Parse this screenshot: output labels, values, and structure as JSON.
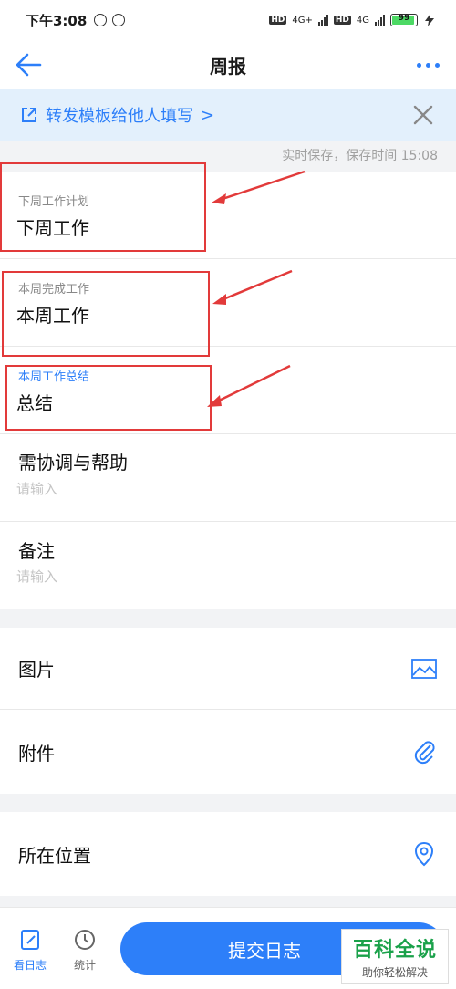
{
  "status_bar": {
    "time": "下午3:08",
    "network_1": "4G+",
    "network_2": "4G",
    "hd": "HD",
    "battery": "99"
  },
  "nav": {
    "title": "周报"
  },
  "banner": {
    "text": "转发模板给他人填写",
    "chevron": ">"
  },
  "save_status": "实时保存，保存时间 15:08",
  "fields": [
    {
      "label": "下周工作计划",
      "value": "下周工作"
    },
    {
      "label": "本周完成工作",
      "value": "本周工作"
    },
    {
      "label": "本周工作总结",
      "value": "总结"
    },
    {
      "label": "需协调与帮助",
      "placeholder": "请输入"
    },
    {
      "label": "备注",
      "placeholder": "请输入"
    }
  ],
  "attachments": {
    "image_label": "图片",
    "file_label": "附件",
    "location_label": "所在位置"
  },
  "tab_bar": {
    "view_log": "看日志",
    "stats": "统计",
    "submit": "提交日志"
  },
  "watermark": {
    "line1": "百科全说",
    "line2": "助你轻松解决"
  },
  "colors": {
    "accent": "#2d7ff9",
    "annotation_red": "#e23a3a",
    "banner_bg": "#e3f0fc"
  }
}
